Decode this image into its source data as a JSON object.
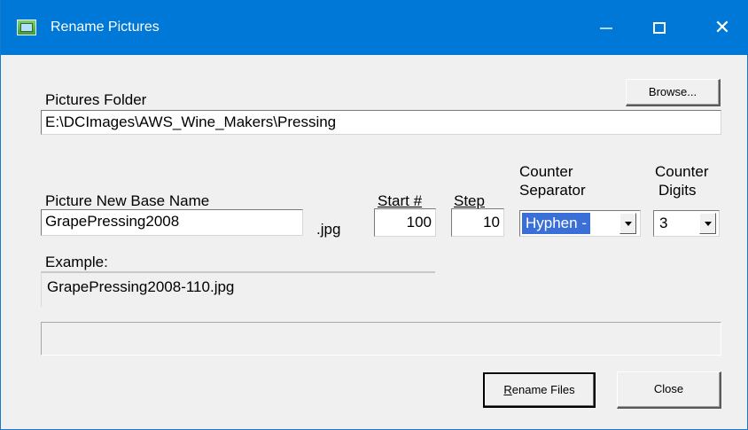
{
  "window": {
    "title": "Rename Pictures",
    "app_icon": "pictures-app-icon",
    "minimize_glyph": "",
    "close_glyph": "✕"
  },
  "folder": {
    "label": "Pictures Folder",
    "value": "E:\\DCImages\\AWS_Wine_Makers\\Pressing",
    "browse_label": "Browse..."
  },
  "base_name": {
    "label": "Picture New Base Name",
    "value": "GrapePressing2008",
    "extension": ".jpg"
  },
  "start": {
    "label": "Start #",
    "value": "100"
  },
  "step": {
    "label": "Step",
    "value": "10"
  },
  "separator": {
    "label_line1": "Counter",
    "label_line2": "Separator",
    "selected": "Hyphen -"
  },
  "digits": {
    "label_line1": "Counter",
    "label_line2": "Digits",
    "selected": "3"
  },
  "example": {
    "label": "Example:",
    "value": "GrapePressing2008-110.jpg"
  },
  "progress": {
    "value": 0
  },
  "buttons": {
    "rename_first_letter": "R",
    "rename_rest": "ename Files",
    "close": "Close"
  },
  "colors": {
    "titlebar": "#0078d7",
    "selection": "#3a6fd8",
    "dialog_bg": "#f0f0f0"
  }
}
